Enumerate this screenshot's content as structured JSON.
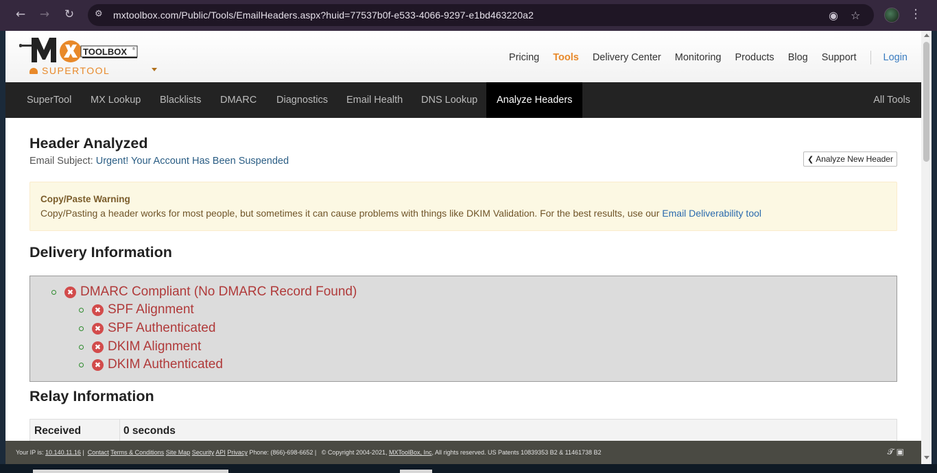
{
  "browser": {
    "url": "mxtoolbox.com/Public/Tools/EmailHeaders.aspx?huid=77537b0f-e533-4066-9297-e1bd463220a2",
    "icons": [
      "back-icon",
      "forward-icon",
      "reload-icon",
      "site-info-icon",
      "eye-off-icon",
      "star-icon",
      "profile-avatar",
      "menu-icon"
    ]
  },
  "header": {
    "logo_alt": "MXTOOLBOX",
    "supertool_label": "SUPERTOOL",
    "nav": {
      "pricing": "Pricing",
      "tools": "Tools",
      "delivery_center": "Delivery Center",
      "monitoring": "Monitoring",
      "products": "Products",
      "blog": "Blog",
      "support": "Support",
      "login": "Login"
    }
  },
  "toolbar": {
    "tabs": [
      "SuperTool",
      "MX Lookup",
      "Blacklists",
      "DMARC",
      "Diagnostics",
      "Email Health",
      "DNS Lookup",
      "Analyze Headers"
    ],
    "active_tab": "Analyze Headers",
    "all_tools": "All Tools"
  },
  "main": {
    "title": "Header Analyzed",
    "subject_label": "Email Subject:",
    "subject_value": "Urgent! Your Account Has Been Suspended",
    "analyze_button": "Analyze New Header",
    "warning": {
      "title": "Copy/Paste Warning",
      "body": "Copy/Pasting a header works for most people, but sometimes it can cause problems with things like DKIM Validation. For the best results, use our",
      "link": "Email Deliverability tool"
    },
    "delivery_title": "Delivery Information",
    "delivery_items": {
      "dmarc": "DMARC Compliant (No DMARC Record Found)",
      "spf_alignment": "SPF Alignment",
      "spf_authenticated": "SPF Authenticated",
      "dkim_alignment": "DKIM Alignment",
      "dkim_authenticated": "DKIM Authenticated"
    },
    "relay_title": "Relay Information",
    "relay_table": {
      "col1": "Received",
      "col2": "0 seconds"
    }
  },
  "footer": {
    "ip_label": "Your IP is:",
    "ip": "10.140.11.16",
    "links": [
      "Contact",
      "Terms & Conditions",
      "Site Map",
      "Security",
      "API",
      "Privacy"
    ],
    "phone": "Phone: (866)-698-6652",
    "copyright": "© Copyright 2004-2021,",
    "company": "MXToolBox, Inc",
    "rights": ", All rights reserved. US Patents 10839353 B2 & 11461738 B2"
  },
  "colors": {
    "accent_orange": "#e8892a",
    "link_blue": "#3a7cc0",
    "fail_red": "#b03a3a",
    "toolbar_bg": "#232323"
  }
}
